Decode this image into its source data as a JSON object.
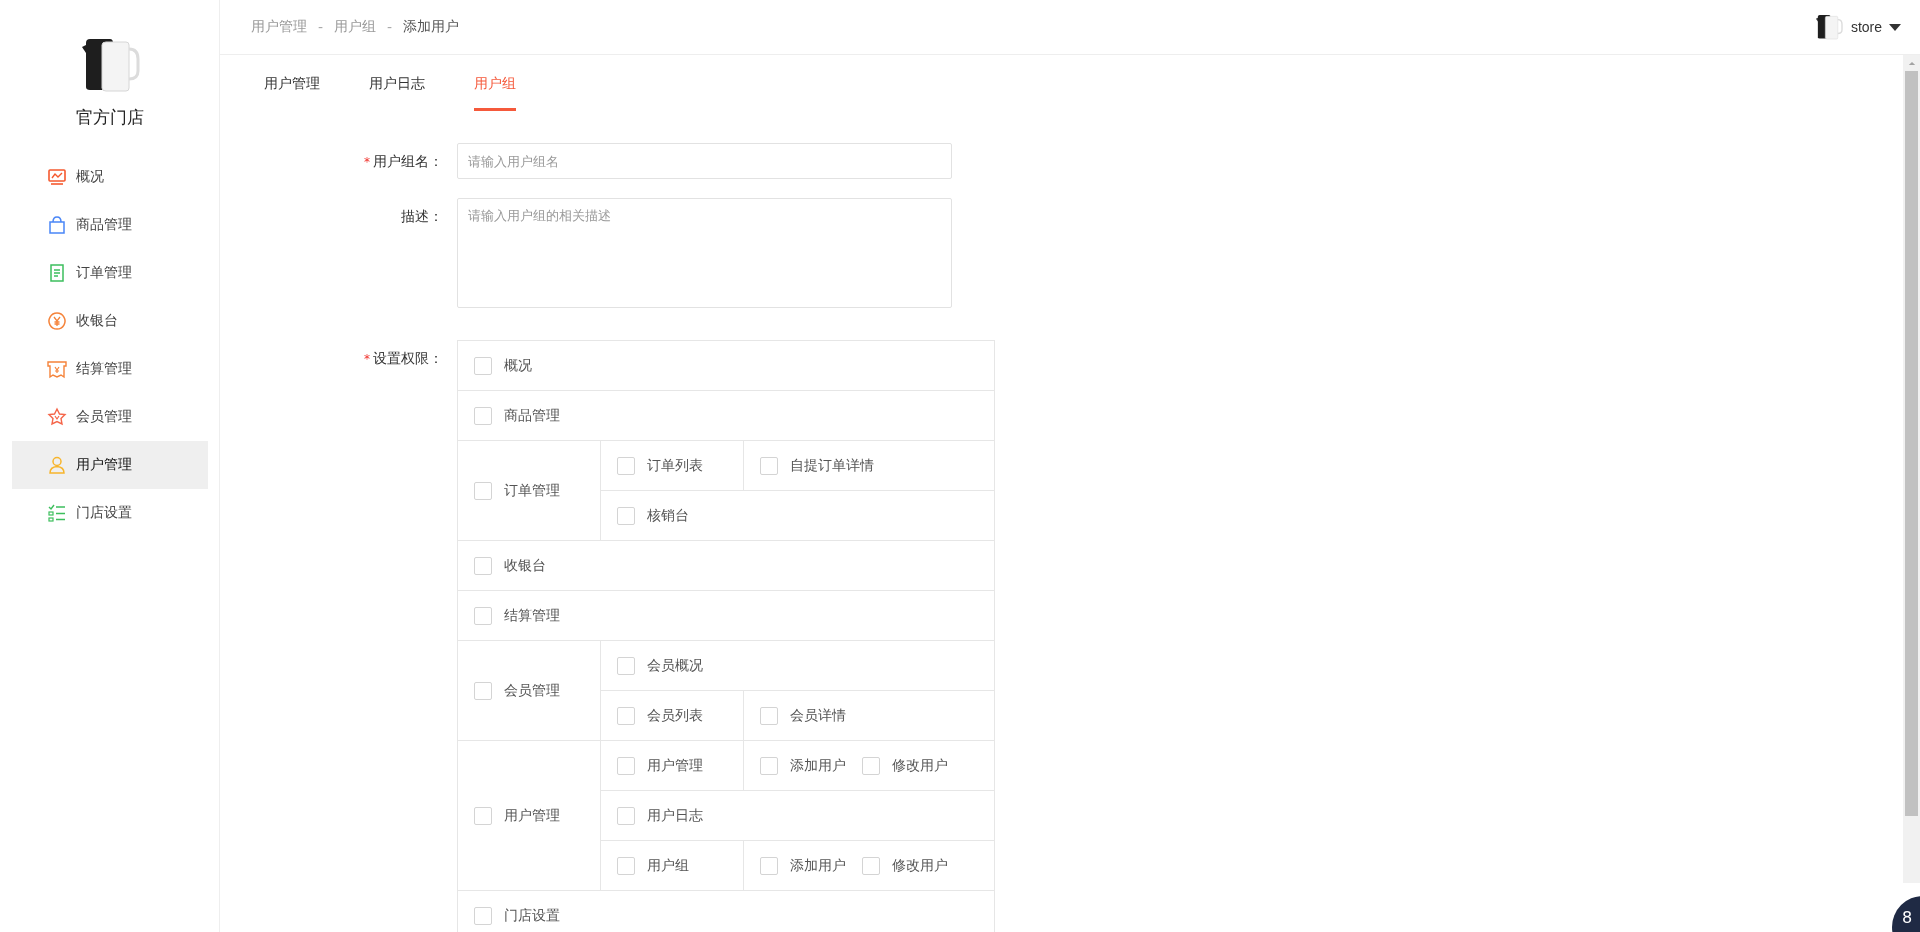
{
  "sidebar": {
    "store_name": "官方门店",
    "items": [
      {
        "label": "概况",
        "kind": "chart",
        "selected": false
      },
      {
        "label": "商品管理",
        "kind": "bag",
        "selected": false
      },
      {
        "label": "订单管理",
        "kind": "doc",
        "selected": false
      },
      {
        "label": "收银台",
        "kind": "cash",
        "selected": false
      },
      {
        "label": "结算管理",
        "kind": "bill",
        "selected": false
      },
      {
        "label": "会员管理",
        "kind": "star",
        "selected": false
      },
      {
        "label": "用户管理",
        "kind": "user",
        "selected": true
      },
      {
        "label": "门店设置",
        "kind": "list",
        "selected": false
      }
    ]
  },
  "breadcrumb": [
    {
      "label": "用户管理",
      "current": false
    },
    {
      "label": "用户组",
      "current": false
    },
    {
      "label": "添加用户",
      "current": true
    }
  ],
  "breadcrumb_separator": "-",
  "account": {
    "name": "store"
  },
  "tabs": [
    {
      "label": "用户管理",
      "selected": false
    },
    {
      "label": "用户日志",
      "selected": false
    },
    {
      "label": "用户组",
      "selected": true
    }
  ],
  "form": {
    "fields": [
      {
        "label": "用户组名：",
        "asterisk": "*",
        "kind": "input",
        "placeholder": "请输入用户组名"
      },
      {
        "label": "描述：",
        "kind": "textarea",
        "placeholder": "请输入用户组的相关描述"
      }
    ],
    "permissions": {
      "label": "设置权限：",
      "asterisk": "*",
      "groups": [
        {
          "label": "概况",
          "checked": false
        },
        {
          "label": "商品管理",
          "checked": false
        },
        {
          "label": "订单管理",
          "checked": false,
          "children": [
            {
              "label": "订单列表",
              "checked": false,
              "children": [
                {
                  "label": "自提订单详情",
                  "checked": false
                }
              ]
            },
            {
              "label": "核销台",
              "checked": false
            }
          ]
        },
        {
          "label": "收银台",
          "checked": false
        },
        {
          "label": "结算管理",
          "checked": false
        },
        {
          "label": "会员管理",
          "checked": false,
          "children": [
            {
              "label": "会员概况",
              "checked": false
            },
            {
              "label": "会员列表",
              "checked": false,
              "children": [
                {
                  "label": "会员详情",
                  "checked": false
                }
              ]
            }
          ]
        },
        {
          "label": "用户管理",
          "checked": false,
          "children": [
            {
              "label": "用户管理",
              "checked": false,
              "children": [
                {
                  "label": "添加用户",
                  "checked": false
                },
                {
                  "label": "修改用户",
                  "checked": false
                }
              ]
            },
            {
              "label": "用户日志",
              "checked": false
            },
            {
              "label": "用户组",
              "checked": false,
              "children": [
                {
                  "label": "添加用户",
                  "checked": false
                },
                {
                  "label": "修改用户",
                  "checked": false
                }
              ]
            }
          ]
        },
        {
          "label": "门店设置",
          "checked": false
        }
      ]
    }
  },
  "corner_badge": "8"
}
